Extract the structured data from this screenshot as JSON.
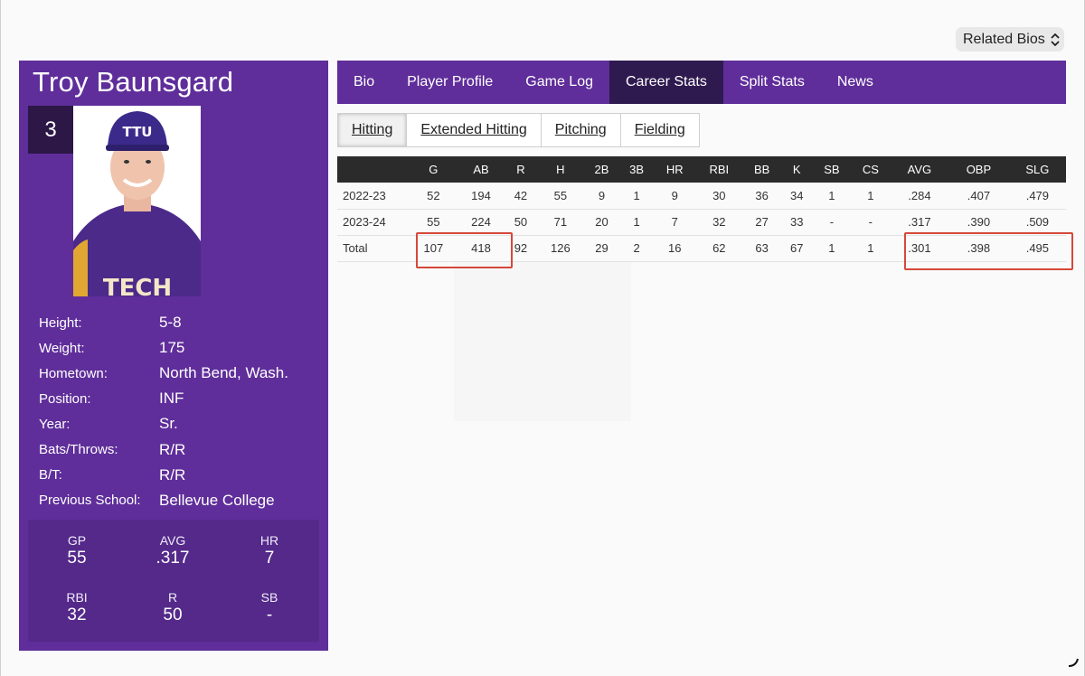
{
  "related_bios": {
    "label": "Related Bios"
  },
  "player": {
    "name": "Troy Baunsgard",
    "number": "3",
    "photo_cap_text": "TTU",
    "photo_jersey_text": "TECH",
    "facts": [
      {
        "label": "Height:",
        "value": "5-8"
      },
      {
        "label": "Weight:",
        "value": "175"
      },
      {
        "label": "Hometown:",
        "value": "North Bend, Wash."
      },
      {
        "label": "Position:",
        "value": "INF"
      },
      {
        "label": "Year:",
        "value": "Sr."
      },
      {
        "label": "Bats/Throws:",
        "value": "R/R"
      },
      {
        "label": "B/T:",
        "value": "R/R"
      },
      {
        "label": "Previous School:",
        "value": "Bellevue College"
      }
    ],
    "quick_stats": [
      {
        "label": "GP",
        "value": "55"
      },
      {
        "label": "AVG",
        "value": ".317"
      },
      {
        "label": "HR",
        "value": "7"
      },
      {
        "label": "RBI",
        "value": "32"
      },
      {
        "label": "R",
        "value": "50"
      },
      {
        "label": "SB",
        "value": "-"
      }
    ]
  },
  "nav": {
    "tabs": [
      {
        "label": "Bio",
        "active": false
      },
      {
        "label": "Player Profile",
        "active": false
      },
      {
        "label": "Game Log",
        "active": false
      },
      {
        "label": "Career Stats",
        "active": true
      },
      {
        "label": "Split Stats",
        "active": false
      },
      {
        "label": "News",
        "active": false
      }
    ]
  },
  "subtabs": [
    {
      "label": "Hitting",
      "active": true
    },
    {
      "label": "Extended Hitting",
      "active": false
    },
    {
      "label": "Pitching",
      "active": false
    },
    {
      "label": "Fielding",
      "active": false
    }
  ],
  "stats_table": {
    "headers": [
      "",
      "G",
      "AB",
      "R",
      "H",
      "2B",
      "3B",
      "HR",
      "RBI",
      "BB",
      "K",
      "SB",
      "CS",
      "AVG",
      "OBP",
      "SLG"
    ],
    "rows": [
      [
        "2022-23",
        "52",
        "194",
        "42",
        "55",
        "9",
        "1",
        "9",
        "30",
        "36",
        "34",
        "1",
        "1",
        ".284",
        ".407",
        ".479"
      ],
      [
        "2023-24",
        "55",
        "224",
        "50",
        "71",
        "20",
        "1",
        "7",
        "32",
        "27",
        "33",
        "-",
        "-",
        ".317",
        ".390",
        ".509"
      ],
      [
        "Total",
        "107",
        "418",
        "92",
        "126",
        "29",
        "2",
        "16",
        "62",
        "63",
        "67",
        "1",
        "1",
        ".301",
        ".398",
        ".495"
      ]
    ]
  },
  "colors": {
    "brand_purple": "#5f2e9a",
    "active_tab": "#2f1a50",
    "table_header": "#2b2b2b",
    "highlight": "#d4483a"
  }
}
